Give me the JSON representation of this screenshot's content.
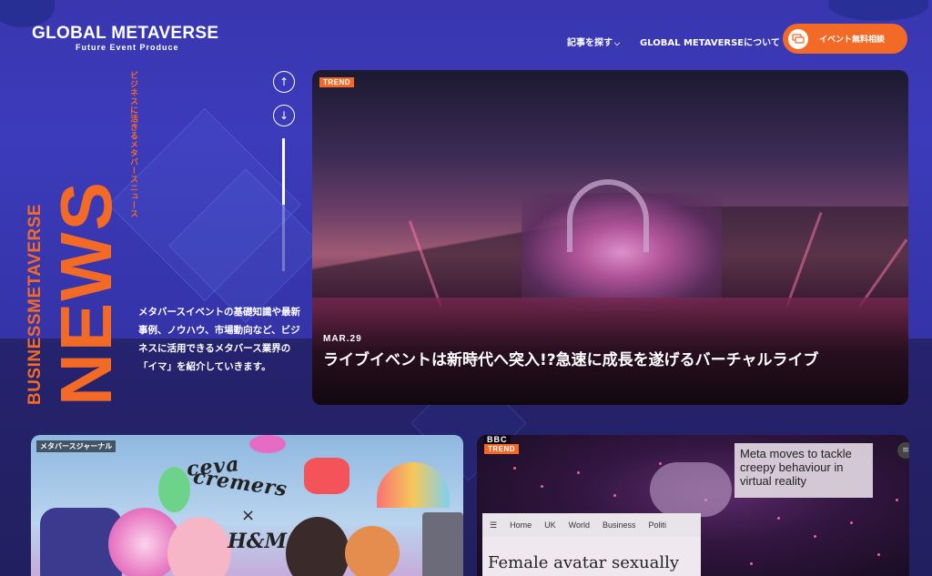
{
  "header": {
    "logo_main": "GLOBAL METAVERSE",
    "logo_sub": "Future Event Produce",
    "nav": [
      {
        "label": "記事を探す",
        "has_dropdown": true
      },
      {
        "label": "GLOBAL METAVERSEについて",
        "has_dropdown": false
      }
    ],
    "cta_label": "イベント無料相談",
    "cta_icon": "chat-bubble-icon"
  },
  "brand": {
    "vertical_small": "BUSINESSMETAVERSE",
    "vertical_large": "NEWS",
    "vertical_jp": "ビジネスに活きるメタバースニュース",
    "description": "メタバースイベントの基礎知識や最新事例、ノウハウ、市場動向など、ビジネスに活用できるメタバース業界の「イマ」を紹介していきます。",
    "accent_color": "#f26a25"
  },
  "slider": {
    "up_icon": "arrow-up-icon",
    "down_icon": "arrow-down-icon",
    "progress": 0.5
  },
  "hero": {
    "tag": "TREND",
    "date": "MAR.29",
    "title": "ライブイベントは新時代へ突入!?急速に成長を遂げるバーチャルライブ"
  },
  "cards": [
    {
      "tag": "メタバースジャーナル",
      "image_text": [
        "ceva",
        "cremers",
        "×",
        "H&M"
      ]
    },
    {
      "logo": "BBC",
      "tag": "TREND",
      "headline": "Meta moves to tackle creepy behaviour in virtual reality",
      "nav": [
        "Home",
        "UK",
        "World",
        "Business",
        "Politi"
      ],
      "title": "Female avatar sexually"
    }
  ]
}
